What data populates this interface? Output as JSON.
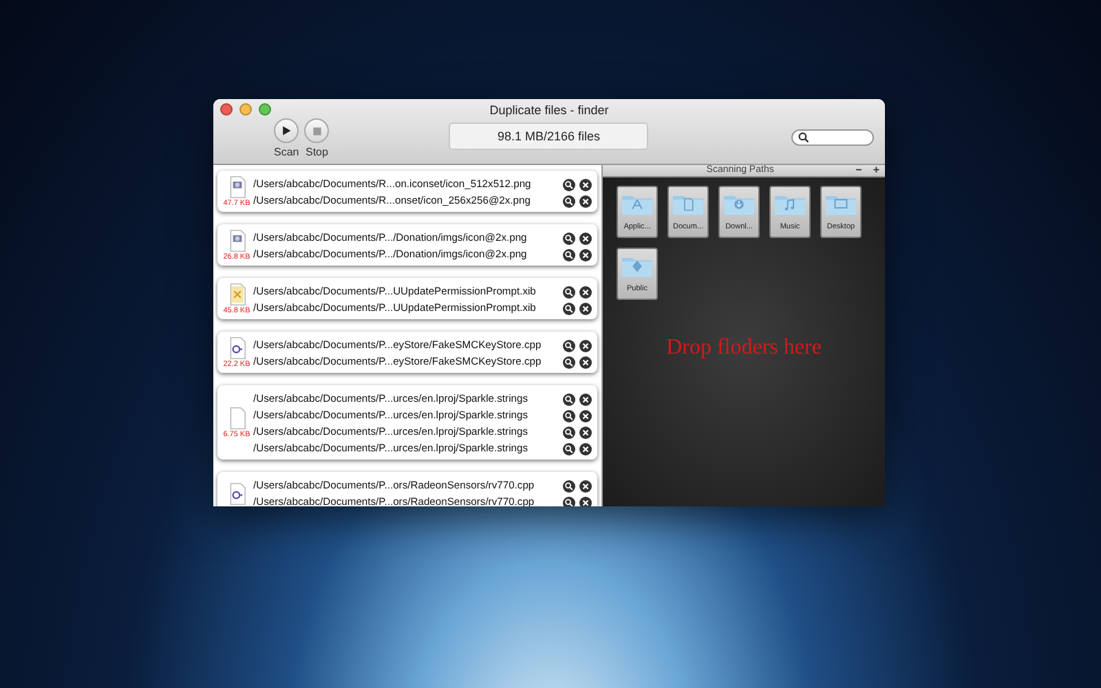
{
  "window": {
    "title": "Duplicate files - finder"
  },
  "toolbar": {
    "buttons": [
      {
        "kind": "play",
        "label": "Scan"
      },
      {
        "kind": "stop",
        "label": "Stop"
      }
    ],
    "status": "98.1 MB/2166 files"
  },
  "groups": [
    {
      "kind": "image",
      "size": "47.7 KB",
      "paths": [
        "/Users/abcabc/Documents/R...on.iconset/icon_512x512.png",
        "/Users/abcabc/Documents/R...onset/icon_256x256@2x.png"
      ]
    },
    {
      "kind": "image",
      "size": "26.8 KB",
      "paths": [
        "/Users/abcabc/Documents/P.../Donation/imgs/icon@2x.png",
        "/Users/abcabc/Documents/P.../Donation/imgs/icon@2x.png"
      ]
    },
    {
      "kind": "xib",
      "size": "45.8 KB",
      "paths": [
        "/Users/abcabc/Documents/P...UUpdatePermissionPrompt.xib",
        "/Users/abcabc/Documents/P...UUpdatePermissionPrompt.xib"
      ]
    },
    {
      "kind": "cpp",
      "size": "22.2 KB",
      "paths": [
        "/Users/abcabc/Documents/P...eyStore/FakeSMCKeyStore.cpp",
        "/Users/abcabc/Documents/P...eyStore/FakeSMCKeyStore.cpp"
      ]
    },
    {
      "kind": "text",
      "size": "6.75 KB",
      "paths": [
        "/Users/abcabc/Documents/P...urces/en.lproj/Sparkle.strings",
        "/Users/abcabc/Documents/P...urces/en.lproj/Sparkle.strings",
        "/Users/abcabc/Documents/P...urces/en.lproj/Sparkle.strings",
        "/Users/abcabc/Documents/P...urces/en.lproj/Sparkle.strings"
      ]
    },
    {
      "kind": "cpp",
      "paths": [
        "/Users/abcabc/Documents/P...ors/RadeonSensors/rv770.cpp",
        "/Users/abcabc/Documents/P...ors/RadeonSensors/rv770.cpp"
      ]
    }
  ],
  "scanning_paths": {
    "title": "Scanning Paths",
    "remove": "−",
    "add": "+",
    "folders": [
      {
        "kind": "apps",
        "label": "Applic..."
      },
      {
        "kind": "docs",
        "label": "Docum..."
      },
      {
        "kind": "downloads",
        "label": "Downl..."
      },
      {
        "kind": "music",
        "label": "Music"
      },
      {
        "kind": "desktop",
        "label": "Desktop"
      },
      {
        "kind": "public",
        "label": "Public"
      }
    ],
    "drop_hint": "Drop floders here"
  }
}
